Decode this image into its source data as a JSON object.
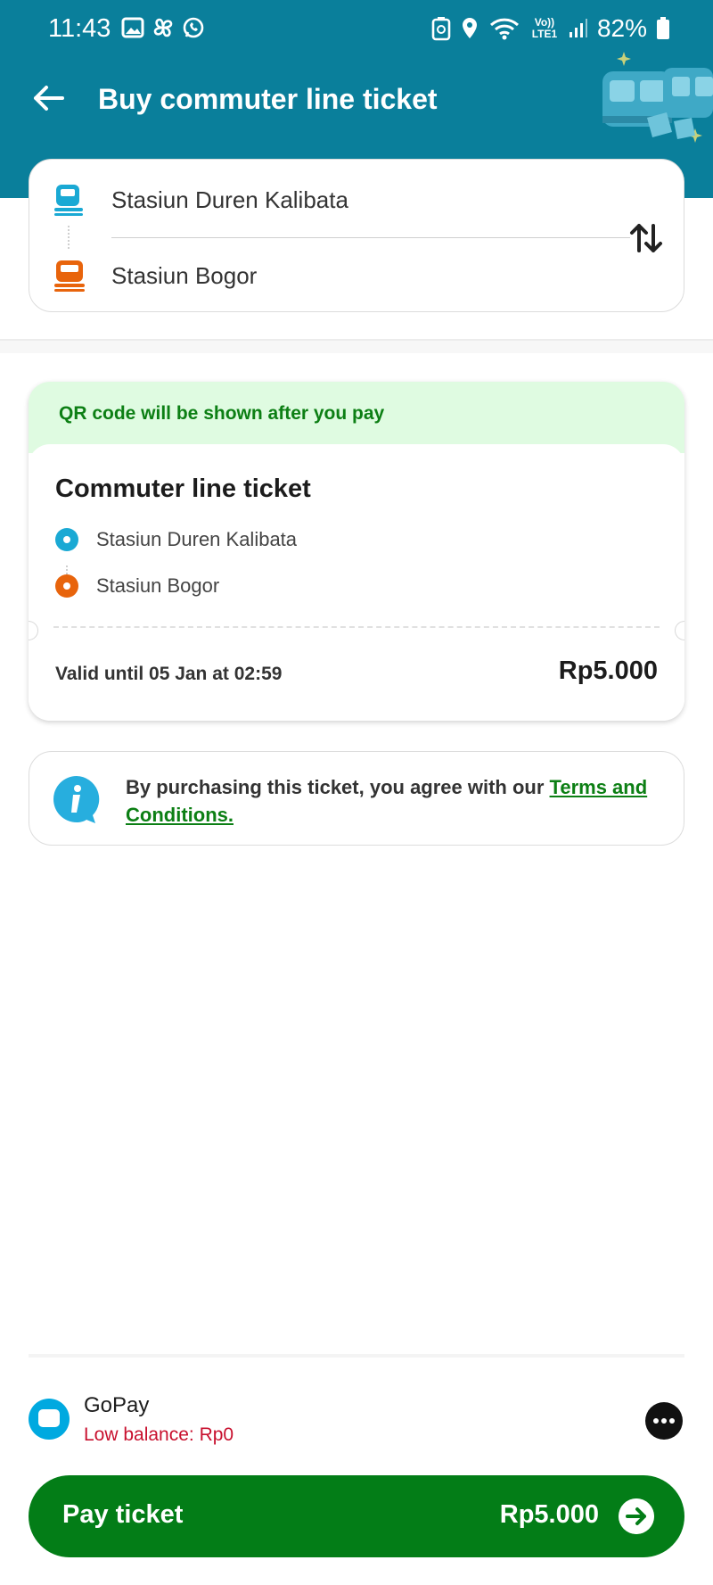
{
  "status_bar": {
    "time": "11:43",
    "network": "Vo)) LTE1",
    "battery": "82%",
    "icons": [
      "image-icon",
      "pinwheel-icon",
      "whatsapp-icon",
      "battery-saver-icon",
      "location-icon",
      "wifi-icon",
      "signal-icon",
      "battery-icon"
    ]
  },
  "header": {
    "title": "Buy commuter line ticket",
    "back_icon": "arrow-left-icon",
    "background": "#0a7f9b"
  },
  "route": {
    "origin": "Stasiun Duren Kalibata",
    "destination": "Stasiun Bogor",
    "origin_color": "#1aa9d4",
    "destination_color": "#e8640c",
    "swap_icon": "swap-vertical-icon"
  },
  "ticket": {
    "banner": "QR code will be shown after you pay",
    "title": "Commuter line ticket",
    "from": "Stasiun Duren Kalibata",
    "to": "Stasiun Bogor",
    "valid_until": "Valid until 05 Jan at 02:59",
    "price": "Rp5.000"
  },
  "terms": {
    "text": "By purchasing this ticket, you agree with our ",
    "link": "Terms and Conditions."
  },
  "payment": {
    "method": "GoPay",
    "balance": "Low balance: Rp0"
  },
  "pay_button": {
    "label": "Pay ticket",
    "amount": "Rp5.000",
    "color": "#037d17"
  }
}
